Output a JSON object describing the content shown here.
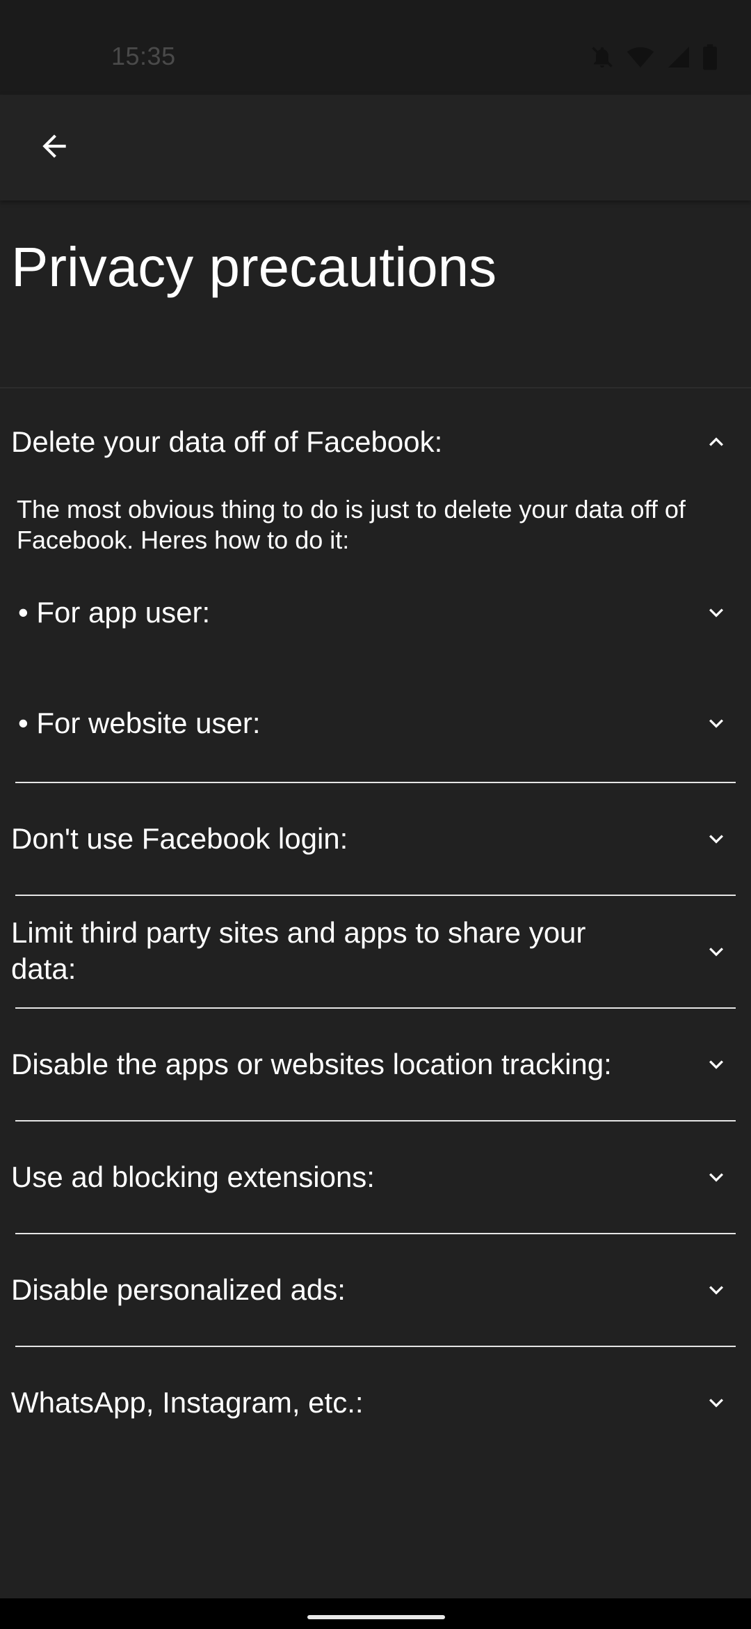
{
  "status_bar": {
    "time": "15:35",
    "icons": [
      "bell-off-icon",
      "wifi-icon",
      "signal-icon",
      "battery-icon"
    ]
  },
  "app_bar": {
    "back_icon": "arrow-left-icon"
  },
  "page": {
    "title": "Privacy precautions"
  },
  "sections": [
    {
      "title": "Delete your data off of Facebook:",
      "expanded": true,
      "intro": "The most obvious thing to do is just to delete your data off of Facebook. Heres how to do it:",
      "sub_items": [
        {
          "label": "• For app user:",
          "expanded": false
        },
        {
          "label": "• For website user:",
          "expanded": false
        }
      ]
    },
    {
      "title": "Don't use Facebook login:",
      "expanded": false
    },
    {
      "title": "Limit third party sites and apps to share your data:",
      "expanded": false
    },
    {
      "title": "Disable the apps or websites location tracking:",
      "expanded": false
    },
    {
      "title": "Use ad blocking extensions:",
      "expanded": false
    },
    {
      "title": "Disable personalized ads:",
      "expanded": false
    },
    {
      "title": "WhatsApp, Instagram, etc.:",
      "expanded": false
    }
  ],
  "colors": {
    "background": "#212121",
    "status_bar": "#1b1b1b",
    "app_bar": "#232323",
    "text": "#ffffff",
    "divider": "#e6e6e6"
  }
}
